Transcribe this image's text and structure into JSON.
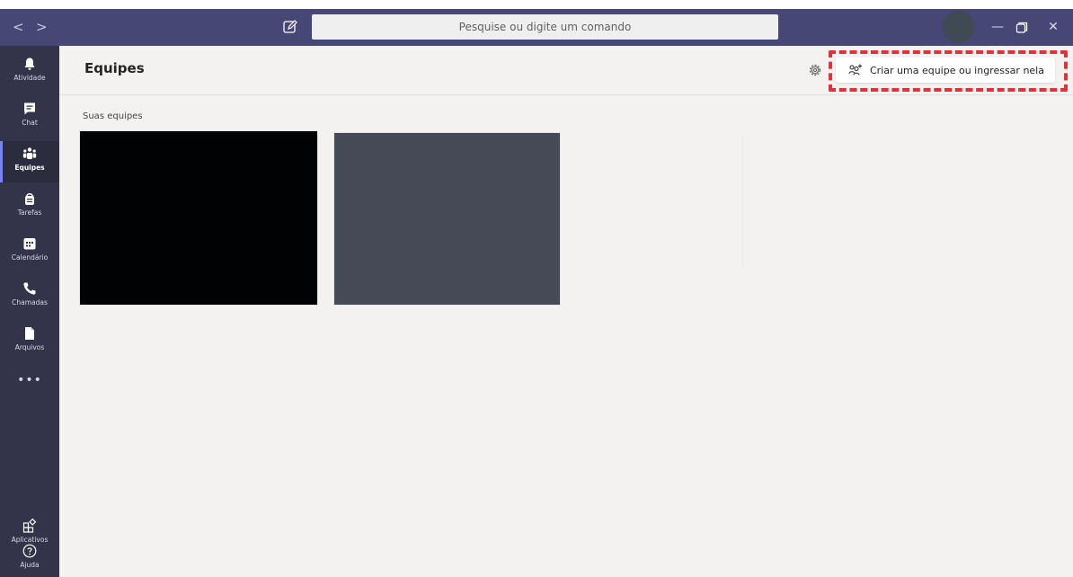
{
  "titlebar": {
    "search_placeholder": "Pesquise ou digite um comando",
    "back_label": "<",
    "forward_label": ">",
    "minimize_label": "—",
    "close_label": "✕"
  },
  "rail": {
    "items": [
      {
        "label": "Atividade",
        "icon": "bell-icon"
      },
      {
        "label": "Chat",
        "icon": "chat-icon"
      },
      {
        "label": "Equipes",
        "icon": "teams-icon",
        "active": true
      },
      {
        "label": "Tarefas",
        "icon": "tasks-icon"
      },
      {
        "label": "Calendário",
        "icon": "calendar-icon"
      },
      {
        "label": "Chamadas",
        "icon": "phone-icon"
      },
      {
        "label": "Arquivos",
        "icon": "file-icon"
      }
    ],
    "more_label": "•••",
    "bottom_items": [
      {
        "label": "Aplicativos",
        "icon": "apps-icon"
      },
      {
        "label": "Ajuda",
        "icon": "help-icon"
      }
    ]
  },
  "main": {
    "title": "Equipes",
    "create_button_label": "Criar uma equipe ou ingressar nela",
    "section_label": "Suas equipes",
    "teams": [
      {
        "color": "#010203"
      },
      {
        "color": "#464a57"
      }
    ]
  },
  "colors": {
    "titlebar": "#464775",
    "rail": "#33344a",
    "accent": "#7b83eb",
    "highlight": "#e03238",
    "background": "#f3f2f1"
  }
}
